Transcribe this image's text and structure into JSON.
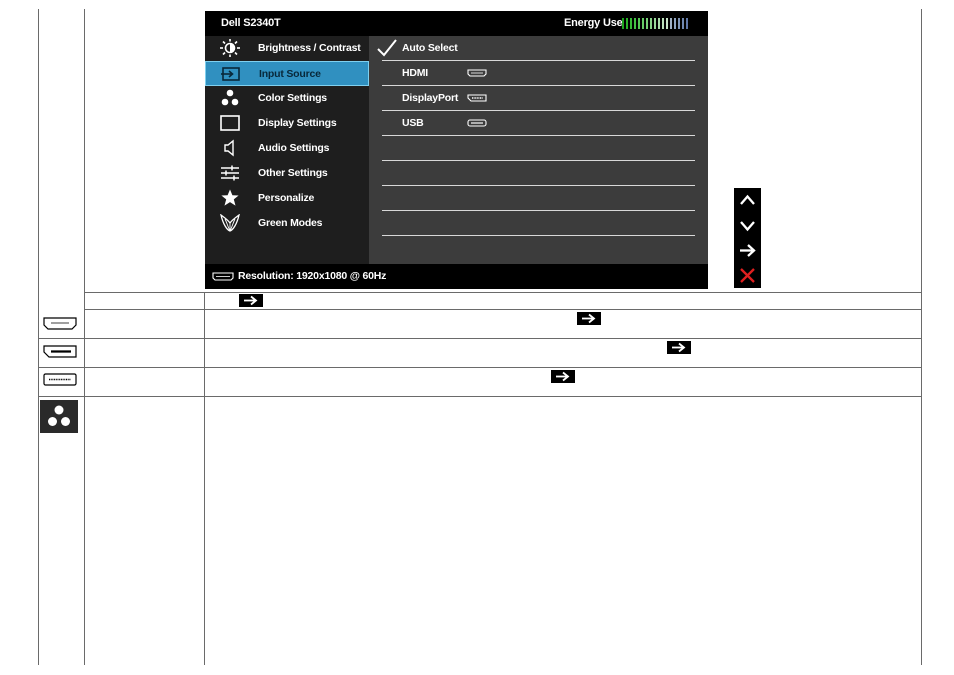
{
  "osd": {
    "model": "Dell S2340T",
    "energy_label": "Energy Use",
    "energy_colors": [
      "#1ea51e",
      "#2bb22b",
      "#37bb37",
      "#44c244",
      "#55c855",
      "#66cc66",
      "#77d077",
      "#88d488",
      "#99d899",
      "#aadcaa",
      "#bbe0bb",
      "#c8e4c8",
      "#9fb0c6",
      "#8fa4c0",
      "#8096b8",
      "#7088b0",
      "#6078a8"
    ],
    "menu": [
      {
        "label": "Brightness / Contrast",
        "icon": "brightness-icon"
      },
      {
        "label": "Input Source",
        "icon": "input-source-icon"
      },
      {
        "label": "Color Settings",
        "icon": "color-settings-icon"
      },
      {
        "label": "Display Settings",
        "icon": "display-settings-icon"
      },
      {
        "label": "Audio Settings",
        "icon": "speaker-icon"
      },
      {
        "label": "Other Settings",
        "icon": "other-settings-icon"
      },
      {
        "label": "Personalize",
        "icon": "star-icon"
      },
      {
        "label": "Green Modes",
        "icon": "leaf-icon"
      }
    ],
    "selected_menu": "Input Source",
    "submenu": [
      {
        "label": "Auto Select",
        "icon": "checkmark-icon"
      },
      {
        "label": "HDMI",
        "icon": "hdmi-port-icon"
      },
      {
        "label": "DisplayPort",
        "icon": "displayport-icon"
      },
      {
        "label": "USB",
        "icon": "usb-port-icon"
      }
    ],
    "footer": "Resolution: 1920x1080 @ 60Hz"
  },
  "nav_buttons": [
    "up-arrow-icon",
    "down-arrow-icon",
    "right-arrow-icon",
    "close-x-icon"
  ],
  "accent": "#3090c0",
  "close_color": "#e02020"
}
